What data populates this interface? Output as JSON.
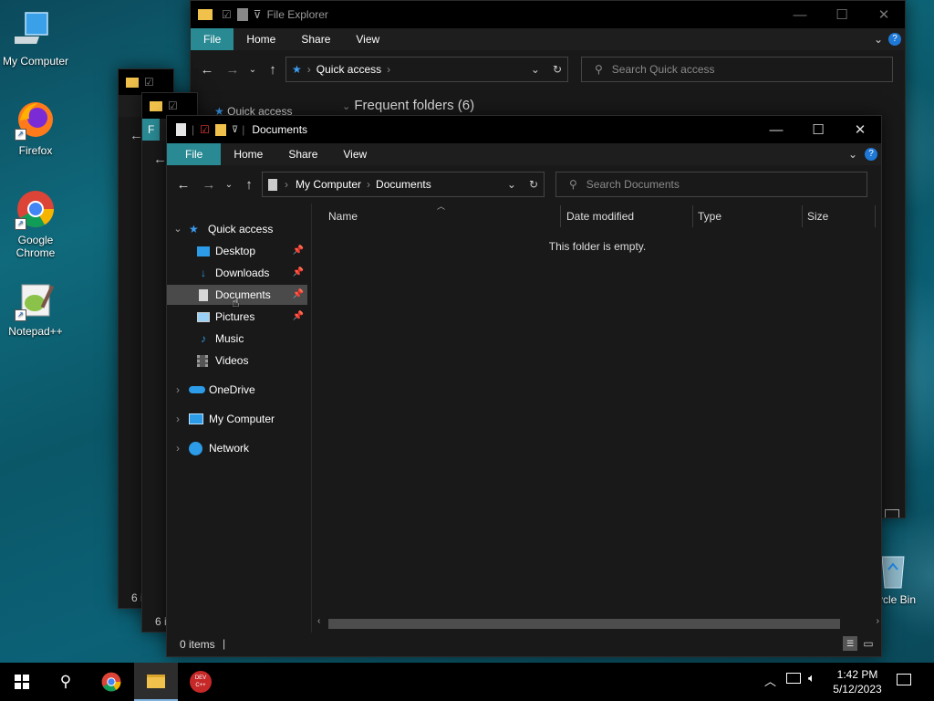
{
  "desktop": {
    "icons": [
      {
        "label": "My Computer"
      },
      {
        "label": "Firefox"
      },
      {
        "label": "Google Chrome"
      },
      {
        "label": "Notepad++"
      },
      {
        "label": "Recycle Bin",
        "visible_label": "ycle Bin"
      }
    ]
  },
  "back_window": {
    "title": "File Explorer",
    "tabs": [
      "File",
      "Home",
      "Share",
      "View"
    ],
    "address": "Quick access",
    "search_placeholder": "Search Quick access",
    "nav_first": "Quick access",
    "section_header": "Frequent folders (6)"
  },
  "mid_windows": {
    "status_a": "6 i",
    "status_b": "6 i",
    "tab_letter": "F"
  },
  "front_window": {
    "title": "Documents",
    "tabs": [
      "File",
      "Home",
      "Share",
      "View"
    ],
    "breadcrumb": [
      "My Computer",
      "Documents"
    ],
    "search_placeholder": "Search Documents",
    "columns": [
      "Name",
      "Date modified",
      "Type",
      "Size"
    ],
    "empty_message": "This folder is empty.",
    "status": "0 items",
    "nav": {
      "quick_access": "Quick access",
      "quick_items": [
        {
          "label": "Desktop",
          "pinned": true
        },
        {
          "label": "Downloads",
          "pinned": true
        },
        {
          "label": "Documents",
          "pinned": true,
          "selected": true
        },
        {
          "label": "Pictures",
          "pinned": true
        },
        {
          "label": "Music",
          "pinned": false
        },
        {
          "label": "Videos",
          "pinned": false
        }
      ],
      "onedrive": "OneDrive",
      "my_computer": "My Computer",
      "network": "Network"
    }
  },
  "taskbar": {
    "time": "1:42 PM",
    "date": "5/12/2023",
    "pinned": [
      "start-icon",
      "search-icon",
      "chrome-icon",
      "file-explorer-icon",
      "dev-cpp-icon"
    ],
    "devcpp_text": "DEV C++"
  },
  "colors": {
    "accent_tab": "#2a8a94",
    "window_bg": "#191919",
    "titlebar": "#000000",
    "selected": "#4a4a4a"
  }
}
